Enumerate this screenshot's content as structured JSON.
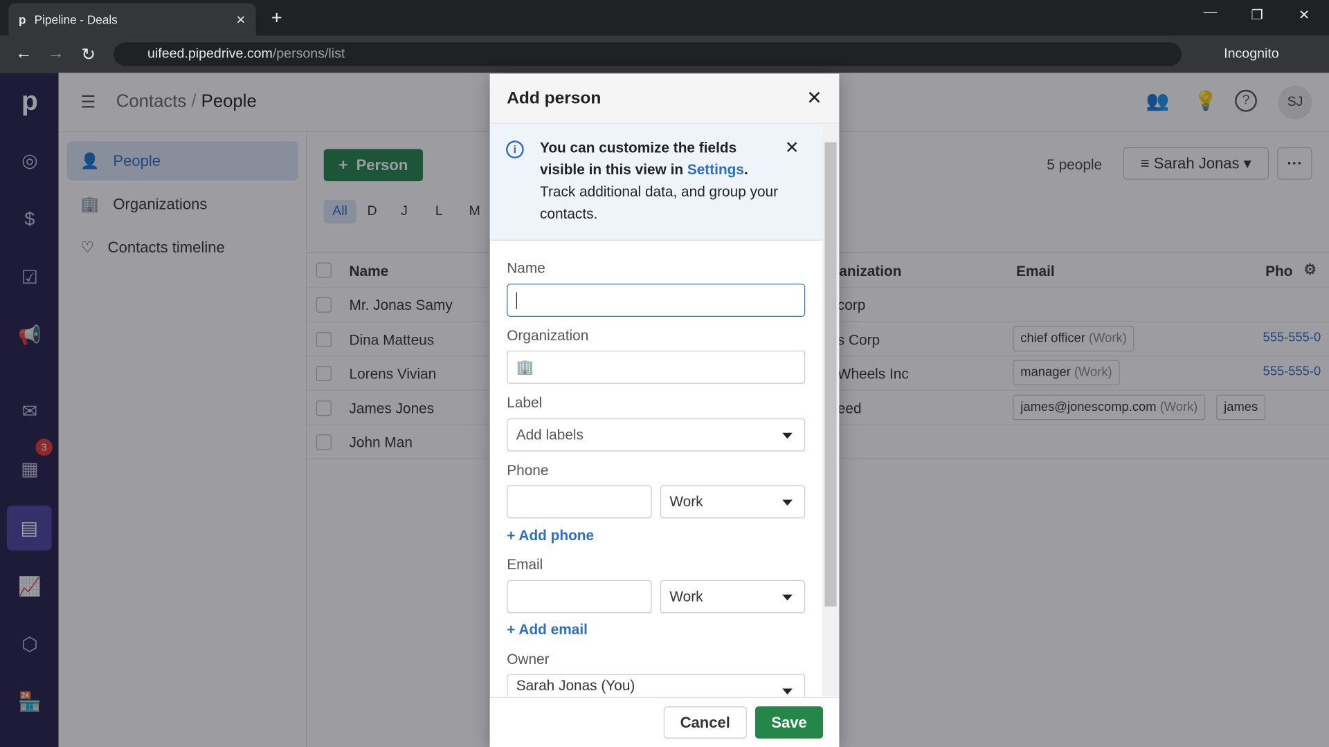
{
  "browser": {
    "tab_title": "Pipeline - Deals",
    "url_host": "uifeed.pipedrive.com",
    "url_path": "/persons/list",
    "profile": "Incognito"
  },
  "header": {
    "breadcrumb_parent": "Contacts",
    "breadcrumb_current": "People",
    "avatar": "SJ"
  },
  "sidebar": {
    "items": [
      {
        "label": "People",
        "active": true
      },
      {
        "label": "Organizations"
      },
      {
        "label": "Contacts timeline"
      }
    ]
  },
  "rail": {
    "badge": "3"
  },
  "toolbar": {
    "add_person": "Person",
    "count": "5 people",
    "filter": "Sarah Jonas",
    "more": "···",
    "letters": [
      "All",
      "D",
      "J",
      "L",
      "M"
    ]
  },
  "table": {
    "columns": [
      "Name",
      "anization",
      "Email",
      "Pho"
    ],
    "rows": [
      {
        "name": "Mr. Jonas Samy",
        "org": "corp",
        "emails": [],
        "phone": ""
      },
      {
        "name": "Dina Matteus",
        "org": "s Corp",
        "emails": [
          {
            "v": "chief officer",
            "t": "(Work)"
          }
        ],
        "phone": "555-555-0"
      },
      {
        "name": "Lorens Vivian",
        "org": "Wheels Inc",
        "emails": [
          {
            "v": "manager",
            "t": "(Work)"
          }
        ],
        "phone": "555-555-0"
      },
      {
        "name": "James Jones",
        "org": "eed",
        "emails": [
          {
            "v": "james@jonescomp.com",
            "t": "(Work)"
          },
          {
            "v": "james",
            "t": ""
          }
        ],
        "phone": ""
      },
      {
        "name": "John Man",
        "org": "",
        "emails": [],
        "phone": ""
      }
    ]
  },
  "modal": {
    "title": "Add person",
    "info_bold": "You can customize the fields visible in this view in ",
    "info_link": "Settings",
    "info_dot": ".",
    "info_rest": "Track additional data, and group your contacts.",
    "name_label": "Name",
    "org_label": "Organization",
    "label_label": "Label",
    "label_placeholder": "Add labels",
    "phone_label": "Phone",
    "phone_type": "Work",
    "add_phone": "+ Add phone",
    "email_label": "Email",
    "email_type": "Work",
    "add_email": "+ Add email",
    "owner_label": "Owner",
    "owner_value": "Sarah Jonas (You)",
    "cancel": "Cancel",
    "save": "Save"
  },
  "colors": {
    "primary_green": "#25864a",
    "link": "#2e6fbf",
    "rail": "#26224b"
  }
}
